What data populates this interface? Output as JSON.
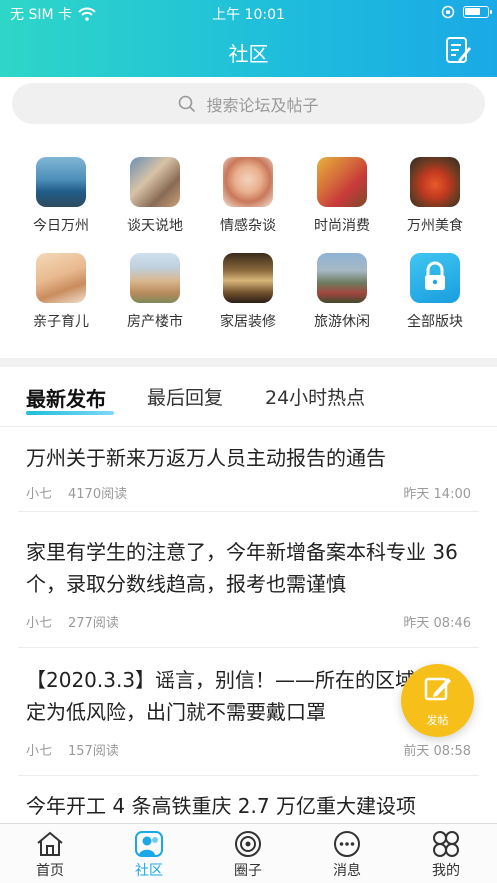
{
  "status_bar": {
    "carrier": "无 SIM 卡",
    "time": "上午 10:01"
  },
  "header": {
    "title": "社区"
  },
  "search": {
    "placeholder": "搜索论坛及帖子"
  },
  "categories": [
    {
      "label": "今日万州"
    },
    {
      "label": "谈天说地"
    },
    {
      "label": "情感杂谈"
    },
    {
      "label": "时尚消费"
    },
    {
      "label": "万州美食"
    },
    {
      "label": "亲子育儿"
    },
    {
      "label": "房产楼市"
    },
    {
      "label": "家居装修"
    },
    {
      "label": "旅游休闲"
    },
    {
      "label": "全部版块"
    }
  ],
  "tabs": [
    {
      "label": "最新发布"
    },
    {
      "label": "最后回复"
    },
    {
      "label": "24小时热点"
    }
  ],
  "posts": [
    {
      "title": "万州关于新来万返万人员主动报告的通告",
      "author": "小七",
      "reads": "4170阅读",
      "time": "昨天 14:00"
    },
    {
      "title": "家里有学生的注意了，今年新增备案本科专业 36 个，录取分数线趋高，报考也需谨慎",
      "author": "小七",
      "reads": "277阅读",
      "time": "昨天 08:46"
    },
    {
      "title": "【2020.3.3】谣言，别信！——所在的区域被认定为低风险，出门就不需要戴口罩",
      "author": "小七",
      "reads": "157阅读",
      "time": "前天 08:58"
    },
    {
      "title": "今年开工 4 条高铁重庆 2.7 万亿重大建设项"
    }
  ],
  "fab": {
    "label": "发帖"
  },
  "tabbar": [
    {
      "label": "首页"
    },
    {
      "label": "社区"
    },
    {
      "label": "圈子"
    },
    {
      "label": "消息"
    },
    {
      "label": "我的"
    }
  ],
  "colors": {
    "accent": "#1aa9e6",
    "fab": "#f7bf1a",
    "header_gradient": [
      "#2ed6c7",
      "#1aa9e6"
    ]
  }
}
